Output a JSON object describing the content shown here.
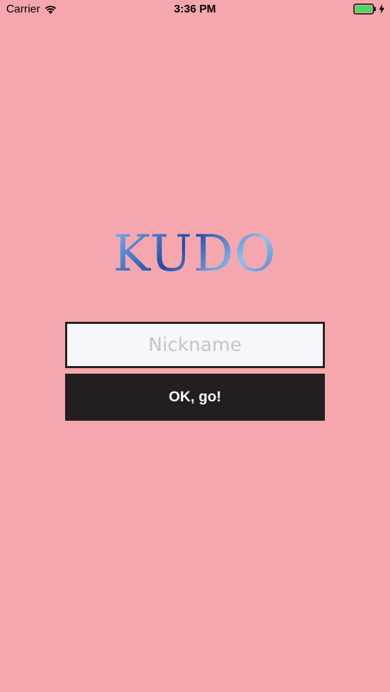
{
  "status_bar": {
    "carrier": "Carrier",
    "time": "3:36 PM",
    "wifi_icon": "wifi-icon",
    "battery_icon": "battery-icon",
    "charging_icon": "charging-icon",
    "battery_level": 1.0,
    "battery_color": "#4cd964"
  },
  "logo": {
    "text": "KUDO"
  },
  "login": {
    "nickname_placeholder": "Nickname",
    "nickname_value": "",
    "submit_label": "OK, go!"
  },
  "colors": {
    "background": "#f5a7ad",
    "button_background": "#231f20",
    "input_background": "#f7f6fa",
    "logo_blue": "#2e58b8"
  }
}
